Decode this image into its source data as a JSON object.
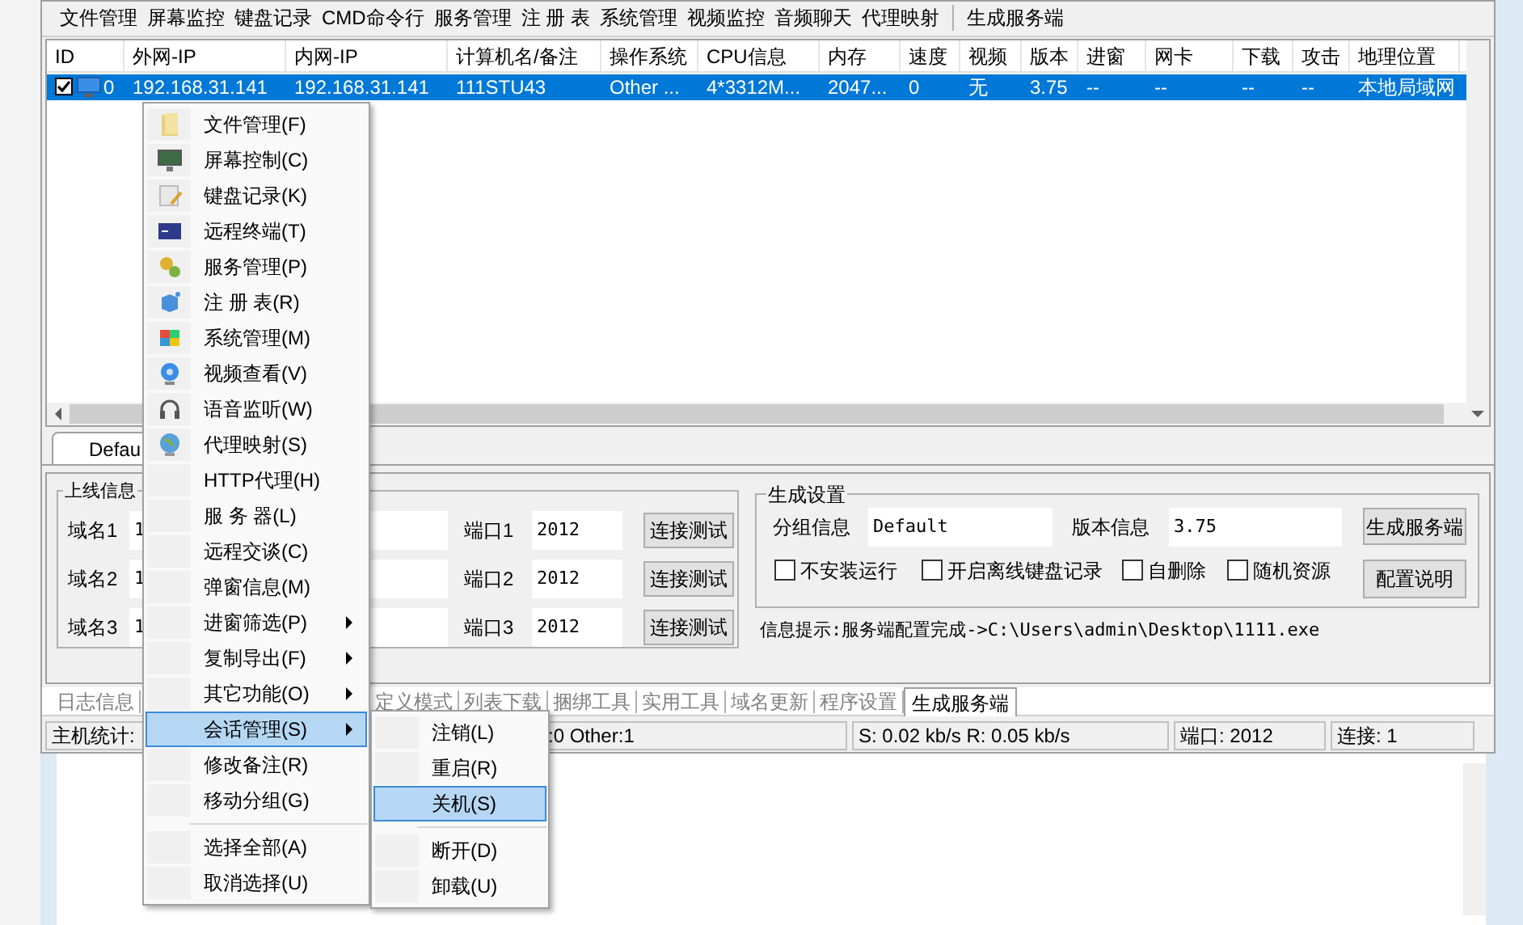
{
  "toolbar": {
    "groups": [
      [
        "文件管理",
        "屏幕监控",
        "键盘记录",
        "CMD命令行",
        "服务管理",
        "注 册 表",
        "系统管理",
        "视频监控",
        "音频聊天",
        "代理映射"
      ],
      [
        "生成服务端"
      ]
    ]
  },
  "host_list": {
    "columns": [
      "ID",
      "外网-IP",
      "内网-IP",
      "计算机名/备注",
      "操作系统",
      "CPU信息",
      "内存",
      "速度",
      "视频",
      "版本",
      "进窗",
      "网卡",
      "下载",
      "攻击",
      "地理位置"
    ],
    "rows": [
      {
        "checked": true,
        "selected": true,
        "cells": [
          "0",
          "192.168.31.141",
          "192.168.31.141",
          "111STU43",
          "Other ...",
          "4*3312M...",
          "2047...",
          "0",
          "无",
          "3.75",
          "--",
          "--",
          "--",
          "--",
          "本地局域网"
        ]
      }
    ]
  },
  "group_tabs": [
    {
      "label": "Defau",
      "selected": true
    }
  ],
  "online_info": {
    "title": "上线信息",
    "rows": [
      {
        "domain_label": "域名1",
        "domain_value": "1",
        "port_label": "端口1",
        "port_value": "2012",
        "button": "连接测试"
      },
      {
        "domain_label": "域名2",
        "domain_value": "1",
        "port_label": "端口2",
        "port_value": "2012",
        "button": "连接测试"
      },
      {
        "domain_label": "域名3",
        "domain_value": "1",
        "port_label": "端口3",
        "port_value": "2012",
        "button": "连接测试"
      }
    ]
  },
  "build_settings": {
    "title": "生成设置",
    "group_label": "分组信息",
    "group_value": "Default",
    "version_label": "版本信息",
    "version_value": "3.75",
    "build_button": "生成服务端",
    "help_button": "配置说明",
    "options": [
      {
        "label": "不安装运行",
        "checked": false
      },
      {
        "label": "开启离线键盘记录",
        "checked": false
      },
      {
        "label": "自删除",
        "checked": false
      },
      {
        "label": "随机资源",
        "checked": false
      }
    ]
  },
  "info_hint": "信息提示:服务端配置完成->C:\\Users\\admin\\Desktop\\1111.exe",
  "bottom_tabs": [
    {
      "label": "日志信息",
      "selected": false
    },
    {
      "label": "定义模式",
      "selected": false
    },
    {
      "label": "列表下载",
      "selected": false
    },
    {
      "label": "捆绑工具",
      "selected": false
    },
    {
      "label": "实用工具",
      "selected": false
    },
    {
      "label": "域名更新",
      "selected": false
    },
    {
      "label": "程序设置",
      "selected": false
    },
    {
      "label": "生成服务端",
      "selected": true
    }
  ],
  "status_bar": [
    "主机统计:",
    ":0  Other:1",
    "S: 0.02 kb/s R: 0.05 kb/s",
    "端口: 2012",
    "连接: 1"
  ],
  "context_menu": {
    "items": [
      {
        "kind": "item",
        "label": "文件管理(F)",
        "selected": false
      },
      {
        "kind": "item",
        "label": "屏幕控制(C)",
        "selected": false
      },
      {
        "kind": "item",
        "label": "键盘记录(K)",
        "selected": false
      },
      {
        "kind": "item",
        "label": "远程终端(T)",
        "selected": false
      },
      {
        "kind": "item",
        "label": "服务管理(P)",
        "selected": false
      },
      {
        "kind": "item",
        "label": "注 册 表(R)",
        "selected": false
      },
      {
        "kind": "item",
        "label": "系统管理(M)",
        "selected": false
      },
      {
        "kind": "item",
        "label": "视频查看(V)",
        "selected": false
      },
      {
        "kind": "item",
        "label": "语音监听(W)",
        "selected": false
      },
      {
        "kind": "item",
        "label": "代理映射(S)",
        "selected": false
      },
      {
        "kind": "item",
        "label": "HTTP代理(H)",
        "selected": false
      },
      {
        "kind": "item",
        "label": "服 务 器(L)",
        "selected": false
      },
      {
        "kind": "item",
        "label": "远程交谈(C)",
        "selected": false
      },
      {
        "kind": "item",
        "label": "弹窗信息(M)",
        "selected": false
      },
      {
        "kind": "submenu",
        "label": "进窗筛选(P)",
        "selected": false
      },
      {
        "kind": "submenu",
        "label": "复制导出(F)",
        "selected": false
      },
      {
        "kind": "submenu",
        "label": "其它功能(O)",
        "selected": false
      },
      {
        "kind": "submenu",
        "label": "会话管理(S)",
        "selected": true
      },
      {
        "kind": "item",
        "label": "修改备注(R)",
        "selected": false
      },
      {
        "kind": "item",
        "label": "移动分组(G)",
        "selected": false
      },
      {
        "kind": "separator"
      },
      {
        "kind": "item",
        "label": "选择全部(A)",
        "selected": false
      },
      {
        "kind": "item",
        "label": "取消选择(U)",
        "selected": false
      }
    ]
  },
  "submenu": {
    "items": [
      {
        "kind": "item",
        "label": "注销(L)",
        "selected": false
      },
      {
        "kind": "item",
        "label": "重启(R)",
        "selected": false
      },
      {
        "kind": "item",
        "label": "关机(S)",
        "selected": true
      },
      {
        "kind": "separator"
      },
      {
        "kind": "item",
        "label": "断开(D)",
        "selected": false
      },
      {
        "kind": "item",
        "label": "卸载(U)",
        "selected": false
      }
    ]
  }
}
